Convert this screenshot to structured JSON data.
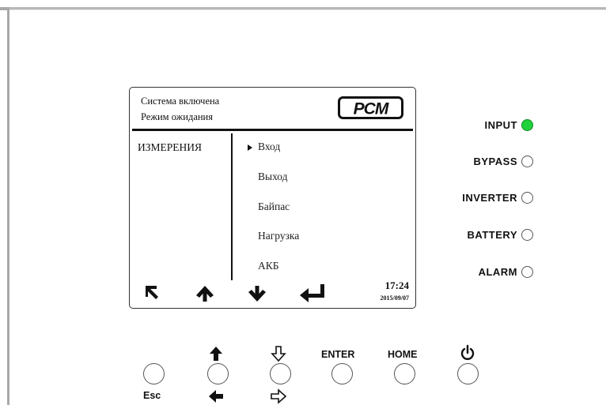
{
  "lcd": {
    "status_line1": "Система включена",
    "status_line2": "Режим ожидания",
    "logo_text": "PCM",
    "section_title": "ИЗМЕРЕНИЯ",
    "menu_items": [
      "Вход",
      "Выход",
      "Байпас",
      "Нагрузка",
      "АКБ"
    ],
    "selected_index": 0,
    "nav_icons": [
      "back-icon",
      "arrow-up-icon",
      "arrow-down-icon",
      "enter-icon"
    ],
    "time": "17:24",
    "date": "2015/09/07"
  },
  "indicators": [
    {
      "label": "INPUT",
      "state": "on",
      "color": "#1fd13b"
    },
    {
      "label": "BYPASS",
      "state": "off"
    },
    {
      "label": "INVERTER",
      "state": "off"
    },
    {
      "label": "BATTERY",
      "state": "off"
    },
    {
      "label": "ALARM",
      "state": "off"
    }
  ],
  "keys": {
    "esc_label": "Esc",
    "up_icon": "arrow-up-solid-icon",
    "left_icon": "arrow-left-solid-icon",
    "down_icon": "arrow-down-outline-icon",
    "right_icon": "arrow-right-outline-icon",
    "enter_label": "ENTER",
    "home_label": "HOME",
    "power_icon": "power-icon"
  }
}
